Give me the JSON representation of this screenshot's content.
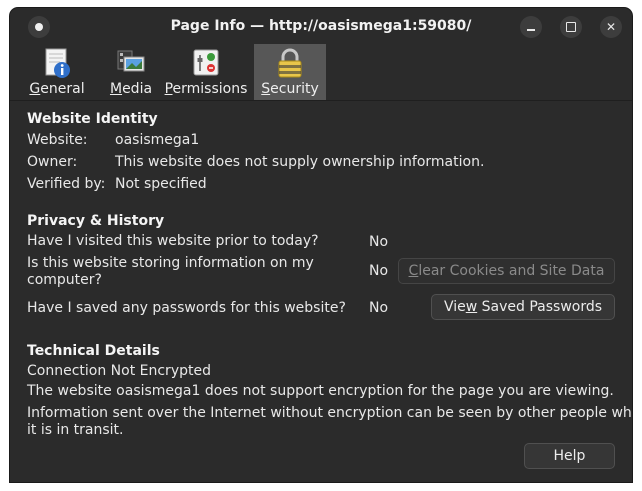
{
  "window": {
    "title": "Page Info — http://oasismega1:59080/"
  },
  "tabs": [
    {
      "label": "General",
      "icon": "info-page-icon",
      "accesskey": "G",
      "active": false
    },
    {
      "label": "Media",
      "icon": "media-icon",
      "accesskey": "M",
      "active": false
    },
    {
      "label": "Permissions",
      "icon": "permissions-icon",
      "accesskey": "P",
      "active": false
    },
    {
      "label": "Security",
      "icon": "lock-icon",
      "accesskey": "S",
      "active": true
    }
  ],
  "identity": {
    "heading": "Website Identity",
    "website_label": "Website:",
    "website_value": "oasismega1",
    "owner_label": "Owner:",
    "owner_value": "This website does not supply ownership information.",
    "verified_label": "Verified by:",
    "verified_value": "Not specified"
  },
  "privacy": {
    "heading": "Privacy & History",
    "q_visited": "Have I visited this website prior to today?",
    "a_visited": "No",
    "q_storing_1": "Is this website storing information on my",
    "q_storing_2": "computer?",
    "a_storing": "No",
    "clear_btn_pre": "",
    "clear_btn_u": "C",
    "clear_btn_post": "lear Cookies and Site Data",
    "q_passwords": "Have I saved any passwords for this website?",
    "a_passwords": "No",
    "view_btn_pre": "Vie",
    "view_btn_u": "w",
    "view_btn_post": " Saved Passwords"
  },
  "technical": {
    "heading": "Technical Details",
    "line1": "Connection Not Encrypted",
    "line2": "The website oasismega1 does not support encryption for the page you are viewing.",
    "line3a": "Information sent over the Internet without encryption can be seen by other people while",
    "line3b": "it is in transit."
  },
  "footer": {
    "help_label": "Help"
  },
  "colors": {
    "window_bg": "#2b2b2b",
    "active_tab": "#575757",
    "button_bg": "#363636"
  }
}
